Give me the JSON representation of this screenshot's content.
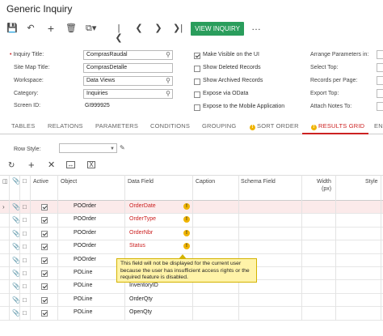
{
  "window": {
    "title": "Generic Inquiry"
  },
  "toolbar": {
    "view_inquiry_label": "VIEW INQUIRY",
    "more_label": "…"
  },
  "form": {
    "inquiry_title_label": "Inquiry Title:",
    "inquiry_title_value": "ComprasRaudal",
    "site_map_title_label": "Site Map Title:",
    "site_map_title_value": "ComprasDetalle",
    "workspace_label": "Workspace:",
    "workspace_value": "Data Views",
    "category_label": "Category:",
    "category_value": "Inquiries",
    "screen_id_label": "Screen ID:",
    "screen_id_value": "GI999925"
  },
  "options": [
    {
      "label": "Make Visible on the UI",
      "checked": true
    },
    {
      "label": "Show Deleted Records",
      "checked": false
    },
    {
      "label": "Show Archived Records",
      "checked": false
    },
    {
      "label": "Expose via OData",
      "checked": false
    },
    {
      "label": "Expose to the Mobile Application",
      "checked": false
    }
  ],
  "right_fields": [
    {
      "label": "Arrange Parameters in:"
    },
    {
      "label": "Select Top:"
    },
    {
      "label": "Records per Page:"
    },
    {
      "label": "Export Top:"
    },
    {
      "label": "Attach Notes To:"
    }
  ],
  "tabs": [
    {
      "label": "TABLES",
      "active": false,
      "warn": false
    },
    {
      "label": "RELATIONS",
      "active": false,
      "warn": false
    },
    {
      "label": "PARAMETERS",
      "active": false,
      "warn": false
    },
    {
      "label": "CONDITIONS",
      "active": false,
      "warn": false
    },
    {
      "label": "GROUPING",
      "active": false,
      "warn": false
    },
    {
      "label": "SORT ORDER",
      "active": false,
      "warn": true
    },
    {
      "label": "RESULTS GRID",
      "active": true,
      "warn": true
    },
    {
      "label": "EN",
      "active": false,
      "warn": false
    }
  ],
  "row_style": {
    "label": "Row Style:",
    "value": ""
  },
  "grid": {
    "columns": {
      "active": "Active",
      "object": "Object",
      "data_field": "Data Field",
      "caption": "Caption",
      "schema_field": "Schema Field",
      "width": "Width",
      "width_unit": "(px)",
      "style": "Style"
    },
    "rows": [
      {
        "object": "POOrder",
        "data_field": "OrderDate",
        "warn": true,
        "highlight": true,
        "current": true
      },
      {
        "object": "POOrder",
        "data_field": "OrderType",
        "warn": true,
        "highlight": false,
        "current": false
      },
      {
        "object": "POOrder",
        "data_field": "OrderNbr",
        "warn": true,
        "highlight": false,
        "current": false
      },
      {
        "object": "POOrder",
        "data_field": "Status",
        "warn": true,
        "highlight": false,
        "current": false
      },
      {
        "object": "POOrder",
        "data_field": "",
        "warn": false,
        "highlight": false,
        "current": false
      },
      {
        "object": "POLine",
        "data_field": "",
        "warn": false,
        "highlight": false,
        "current": false
      },
      {
        "object": "POLine",
        "data_field": "InventoryID",
        "warn": false,
        "highlight": false,
        "current": false
      },
      {
        "object": "POLine",
        "data_field": "OrderQty",
        "warn": false,
        "highlight": false,
        "current": false
      },
      {
        "object": "POLine",
        "data_field": "OpenQty",
        "warn": false,
        "highlight": false,
        "current": false
      }
    ]
  },
  "tooltip": {
    "text": "This field will not be displayed for the current user because the user has insufficient access rights or the required feature is disabled."
  },
  "colors": {
    "accent_green": "#2a9d5c",
    "active_tab_red": "#cc2222",
    "warning_yellow": "#f0b400"
  }
}
